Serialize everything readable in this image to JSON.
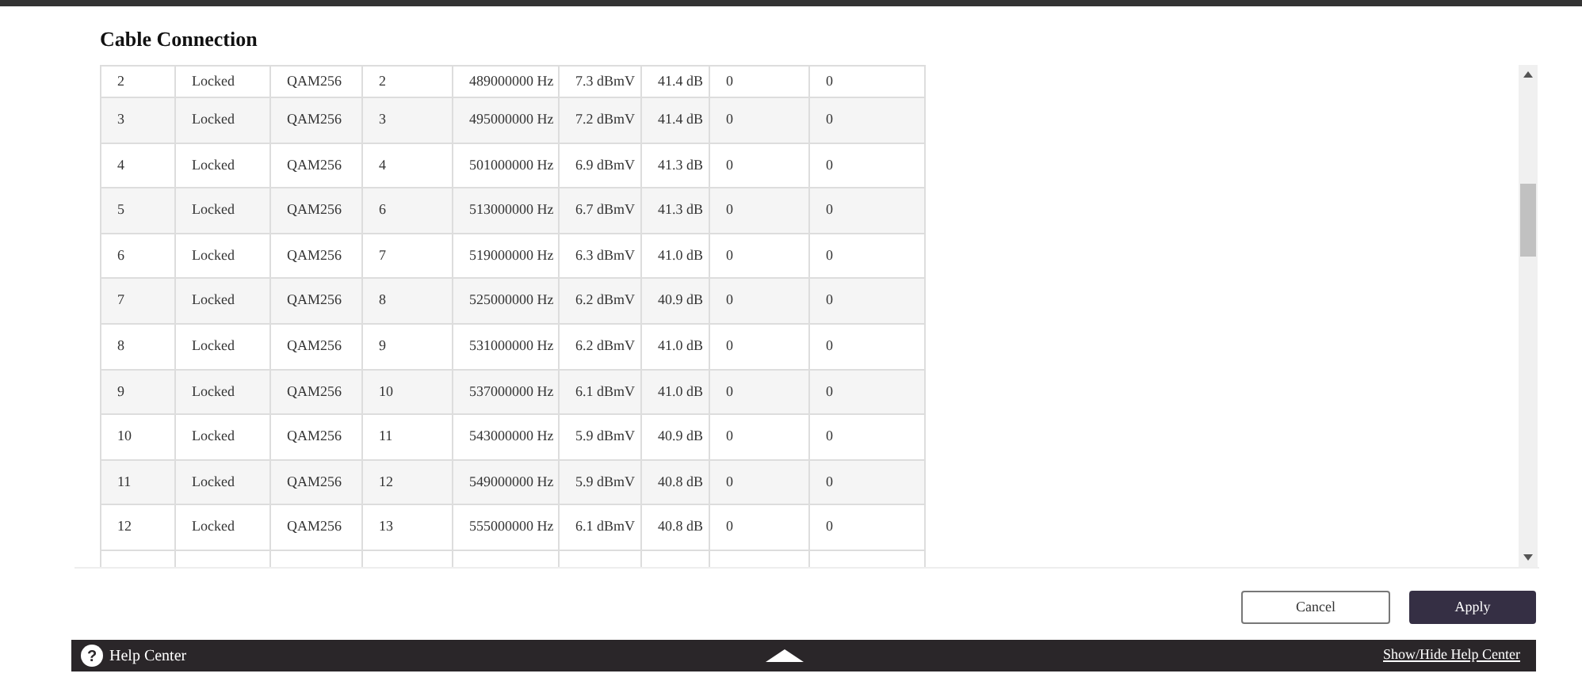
{
  "title": "Cable Connection",
  "table": {
    "rows": [
      [
        "2",
        "Locked",
        "QAM256",
        "2",
        "489000000 Hz",
        "7.3 dBmV",
        "41.4 dB",
        "0",
        "0"
      ],
      [
        "3",
        "Locked",
        "QAM256",
        "3",
        "495000000 Hz",
        "7.2 dBmV",
        "41.4 dB",
        "0",
        "0"
      ],
      [
        "4",
        "Locked",
        "QAM256",
        "4",
        "501000000 Hz",
        "6.9 dBmV",
        "41.3 dB",
        "0",
        "0"
      ],
      [
        "5",
        "Locked",
        "QAM256",
        "6",
        "513000000 Hz",
        "6.7 dBmV",
        "41.3 dB",
        "0",
        "0"
      ],
      [
        "6",
        "Locked",
        "QAM256",
        "7",
        "519000000 Hz",
        "6.3 dBmV",
        "41.0 dB",
        "0",
        "0"
      ],
      [
        "7",
        "Locked",
        "QAM256",
        "8",
        "525000000 Hz",
        "6.2 dBmV",
        "40.9 dB",
        "0",
        "0"
      ],
      [
        "8",
        "Locked",
        "QAM256",
        "9",
        "531000000 Hz",
        "6.2 dBmV",
        "41.0 dB",
        "0",
        "0"
      ],
      [
        "9",
        "Locked",
        "QAM256",
        "10",
        "537000000 Hz",
        "6.1 dBmV",
        "41.0 dB",
        "0",
        "0"
      ],
      [
        "10",
        "Locked",
        "QAM256",
        "11",
        "543000000 Hz",
        "5.9 dBmV",
        "40.9 dB",
        "0",
        "0"
      ],
      [
        "11",
        "Locked",
        "QAM256",
        "12",
        "549000000 Hz",
        "5.9 dBmV",
        "40.8 dB",
        "0",
        "0"
      ],
      [
        "12",
        "Locked",
        "QAM256",
        "13",
        "555000000 Hz",
        "6.1 dBmV",
        "40.8 dB",
        "0",
        "0"
      ]
    ]
  },
  "buttons": [
    {
      "label": "Cancel",
      "kind": "secondary"
    },
    {
      "label": "Apply",
      "kind": "primary"
    }
  ],
  "help_bar": {
    "icon": "?",
    "label": "Help Center",
    "link": "Show/Hide Help Center"
  }
}
